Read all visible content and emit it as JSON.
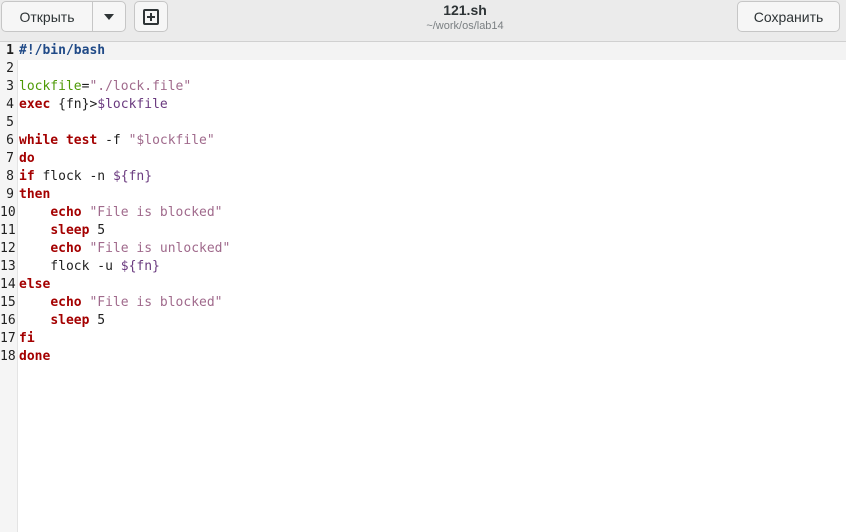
{
  "toolbar": {
    "open_label": "Открыть",
    "save_label": "Сохранить"
  },
  "document": {
    "title": "121.sh",
    "path": "~/work/os/lab14"
  },
  "editor": {
    "current_line": 1,
    "lines": [
      {
        "num": "1",
        "parts": [
          {
            "t": "#!/bin/bash",
            "c": "shebang"
          }
        ]
      },
      {
        "num": "2",
        "parts": []
      },
      {
        "num": "3",
        "parts": [
          {
            "t": "lockfile",
            "c": "assign"
          },
          {
            "t": "=",
            "c": "plain"
          },
          {
            "t": "\"./lock.file\"",
            "c": "str"
          }
        ]
      },
      {
        "num": "4",
        "parts": [
          {
            "t": "exec",
            "c": "kw"
          },
          {
            "t": " {fn}>",
            "c": "plain"
          },
          {
            "t": "$lockfile",
            "c": "var"
          }
        ]
      },
      {
        "num": "5",
        "parts": []
      },
      {
        "num": "6",
        "parts": [
          {
            "t": "while",
            "c": "kw"
          },
          {
            "t": " ",
            "c": "plain"
          },
          {
            "t": "test",
            "c": "kw"
          },
          {
            "t": " -f ",
            "c": "plain"
          },
          {
            "t": "\"$lockfile\"",
            "c": "str"
          }
        ]
      },
      {
        "num": "7",
        "parts": [
          {
            "t": "do",
            "c": "kw"
          }
        ]
      },
      {
        "num": "8",
        "parts": [
          {
            "t": "if",
            "c": "kw"
          },
          {
            "t": " flock -n ",
            "c": "plain"
          },
          {
            "t": "${fn}",
            "c": "var"
          }
        ]
      },
      {
        "num": "9",
        "parts": [
          {
            "t": "then",
            "c": "kw"
          }
        ]
      },
      {
        "num": "10",
        "parts": [
          {
            "t": "    ",
            "c": "plain"
          },
          {
            "t": "echo",
            "c": "kw"
          },
          {
            "t": " ",
            "c": "plain"
          },
          {
            "t": "\"File is blocked\"",
            "c": "str"
          }
        ]
      },
      {
        "num": "11",
        "parts": [
          {
            "t": "    ",
            "c": "plain"
          },
          {
            "t": "sleep",
            "c": "kw"
          },
          {
            "t": " 5",
            "c": "plain"
          }
        ]
      },
      {
        "num": "12",
        "parts": [
          {
            "t": "    ",
            "c": "plain"
          },
          {
            "t": "echo",
            "c": "kw"
          },
          {
            "t": " ",
            "c": "plain"
          },
          {
            "t": "\"File is unlocked\"",
            "c": "str"
          }
        ]
      },
      {
        "num": "13",
        "parts": [
          {
            "t": "    flock -u ",
            "c": "plain"
          },
          {
            "t": "${fn}",
            "c": "var"
          }
        ]
      },
      {
        "num": "14",
        "parts": [
          {
            "t": "else",
            "c": "kw"
          }
        ]
      },
      {
        "num": "15",
        "parts": [
          {
            "t": "    ",
            "c": "plain"
          },
          {
            "t": "echo",
            "c": "kw"
          },
          {
            "t": " ",
            "c": "plain"
          },
          {
            "t": "\"File is blocked\"",
            "c": "str"
          }
        ]
      },
      {
        "num": "16",
        "parts": [
          {
            "t": "    ",
            "c": "plain"
          },
          {
            "t": "sleep",
            "c": "kw"
          },
          {
            "t": " 5",
            "c": "plain"
          }
        ]
      },
      {
        "num": "17",
        "parts": [
          {
            "t": "fi",
            "c": "kw"
          }
        ]
      },
      {
        "num": "18",
        "parts": [
          {
            "t": "done",
            "c": "kw"
          }
        ]
      }
    ]
  },
  "icons": {
    "open_menu": "chevron-down-icon",
    "new_tab": "new-document-icon"
  }
}
